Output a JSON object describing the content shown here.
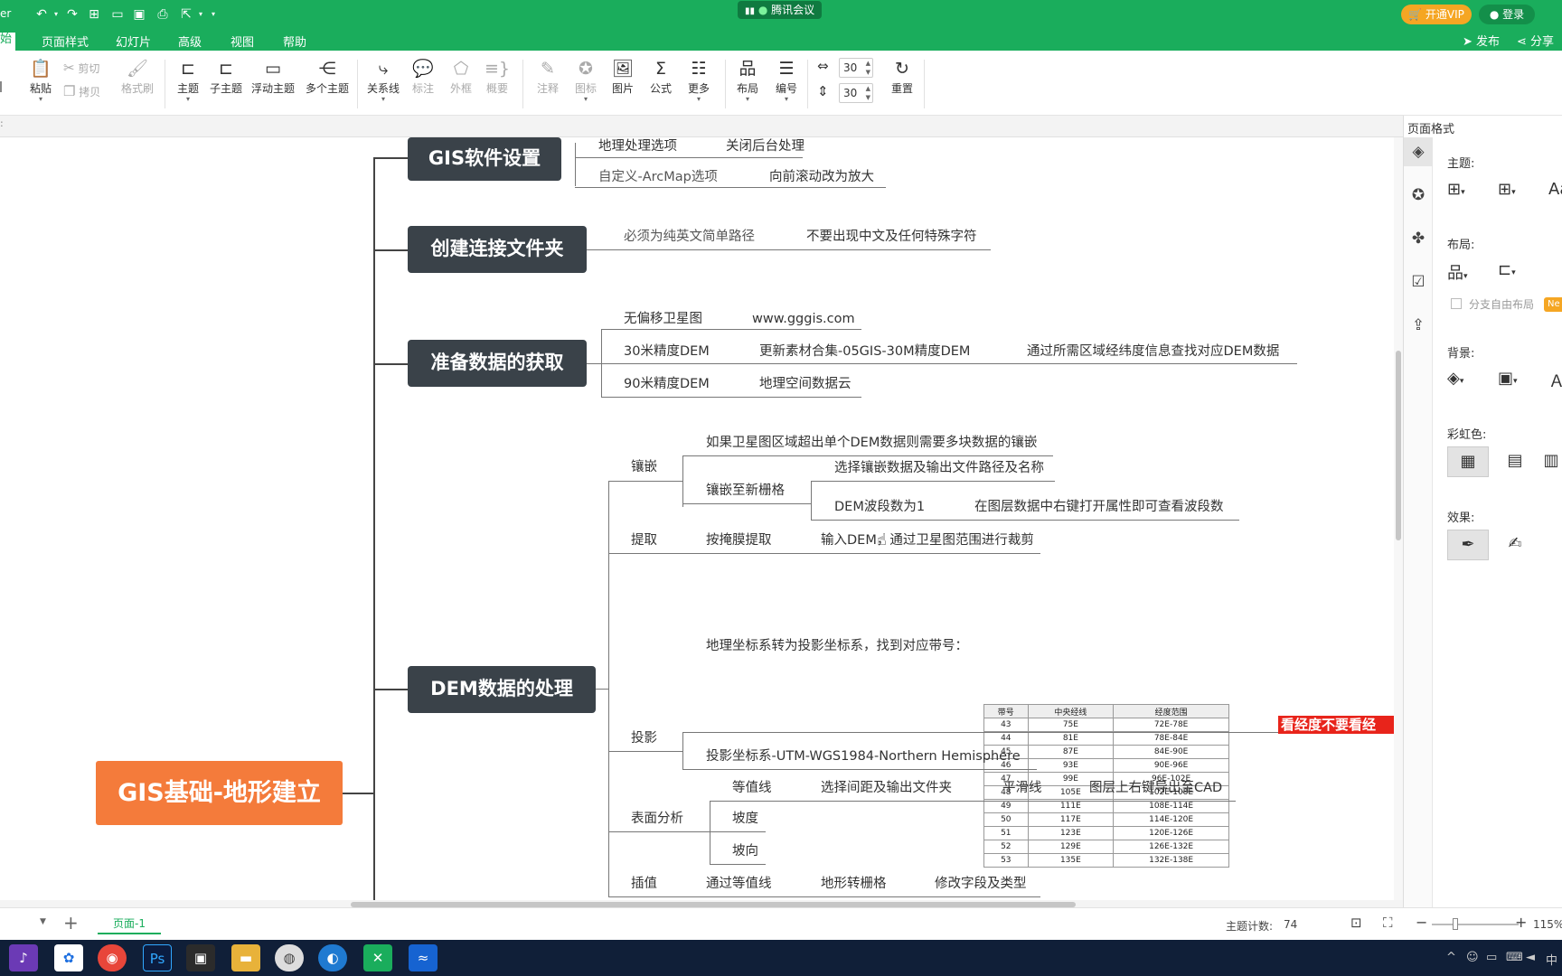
{
  "window": {
    "app_fragment": "er",
    "meeting": "腾讯会议",
    "vip": "开通VIP",
    "login": "登录",
    "publish": "发布",
    "share": "分享"
  },
  "menu_tabs": [
    "始",
    "页面样式",
    "幻灯片",
    "高级",
    "视图",
    "帮助"
  ],
  "ribbon": {
    "paste": "粘贴",
    "cut": "剪切",
    "copy": "拷贝",
    "format_painter": "格式刷",
    "topic": "主题",
    "subtopic": "子主题",
    "float_topic": "浮动主题",
    "multi_topic": "多个主题",
    "relation": "关系线",
    "callout": "标注",
    "boundary": "外框",
    "summary": "概要",
    "note": "注释",
    "icon": "图标",
    "image": "图片",
    "formula": "公式",
    "more": "更多",
    "layout": "布局",
    "numbering": "编号",
    "h_spacing": "30",
    "v_spacing": "30",
    "reset": "重置"
  },
  "mindmap": {
    "root": "GIS基础-地形建立",
    "topics": {
      "gis_settings": "GIS软件设置",
      "folder": "创建连接文件夹",
      "data": "准备数据的获取",
      "dem": "DEM数据的处理"
    },
    "gis_settings": {
      "a1": "地理处理选项",
      "a2": "关闭后台处理",
      "b1": "自定义-ArcMap选项",
      "b2": "向前滚动改为放大"
    },
    "folder": {
      "a1": "必须为纯英文简单路径",
      "a2": "不要出现中文及任何特殊字符"
    },
    "data": {
      "a1": "无偏移卫星图",
      "a2": "www.gggis.com",
      "b1": "30米精度DEM",
      "b2": "更新素材合集-05GIS-30M精度DEM",
      "b3": "通过所需区域经纬度信息查找对应DEM数据",
      "c1": "90米精度DEM",
      "c2": "地理空间数据云"
    },
    "dem": {
      "mosaic": "镶嵌",
      "mosaic_note": "如果卫星图区域超出单个DEM数据则需要多块数据的镶嵌",
      "mosaic_new": "镶嵌至新栅格",
      "mosaic_sel": "选择镶嵌数据及输出文件路径及名称",
      "mosaic_band": "DEM波段数为1",
      "mosaic_band_note": "在图层数据中右键打开属性即可查看波段数",
      "extract": "提取",
      "extract_mask": "按掩膜提取",
      "extract_input": "输入DEM，通过卫星图范围进行裁剪",
      "project": "投影",
      "project_geo": "地理坐标系转为投影坐标系，找到对应带号：",
      "project_sys": "投影坐标系-UTM-WGS1984-Northern Hemisphere",
      "surface": "表面分析",
      "contour": "等值线",
      "contour_sel": "选择间距及输出文件夹",
      "smooth": "平滑线",
      "export_cad": "图层上右键导出至CAD",
      "slope": "坡度",
      "aspect": "坡向",
      "interp": "插值",
      "interp_contour": "通过等值线",
      "terrain_raster": "地形转栅格",
      "edit_field": "修改字段及类型"
    },
    "red_note": "看经度不要看经",
    "zone_table": {
      "headers": [
        "带号",
        "中央经线",
        "经度范围"
      ],
      "rows": [
        [
          "43",
          "75E",
          "72E-78E"
        ],
        [
          "44",
          "81E",
          "78E-84E"
        ],
        [
          "45",
          "87E",
          "84E-90E"
        ],
        [
          "46",
          "93E",
          "90E-96E"
        ],
        [
          "47",
          "99E",
          "96E-102E"
        ],
        [
          "48",
          "105E",
          "102E-108E"
        ],
        [
          "49",
          "111E",
          "108E-114E"
        ],
        [
          "50",
          "117E",
          "114E-120E"
        ],
        [
          "51",
          "123E",
          "120E-126E"
        ],
        [
          "52",
          "129E",
          "126E-132E"
        ],
        [
          "53",
          "135E",
          "132E-138E"
        ]
      ]
    }
  },
  "panel": {
    "title": "页面格式",
    "theme": "主题:",
    "layout": "布局:",
    "free_layout": "分支自由布局",
    "new_tag": "Ne",
    "background": "背景:",
    "rainbow": "彩虹色:",
    "effect": "效果:"
  },
  "status": {
    "page": "页面-1",
    "topic_count_label": "主题计数:",
    "topic_count": "74",
    "zoom": "115%"
  },
  "taskbar": {
    "lang": "中"
  },
  "colors": {
    "brand_green": "#1aad5c",
    "root_orange": "#f47b3b",
    "topic_dark": "#3a4249",
    "vip_gold": "#f5a623",
    "red_note": "#e8241b"
  }
}
